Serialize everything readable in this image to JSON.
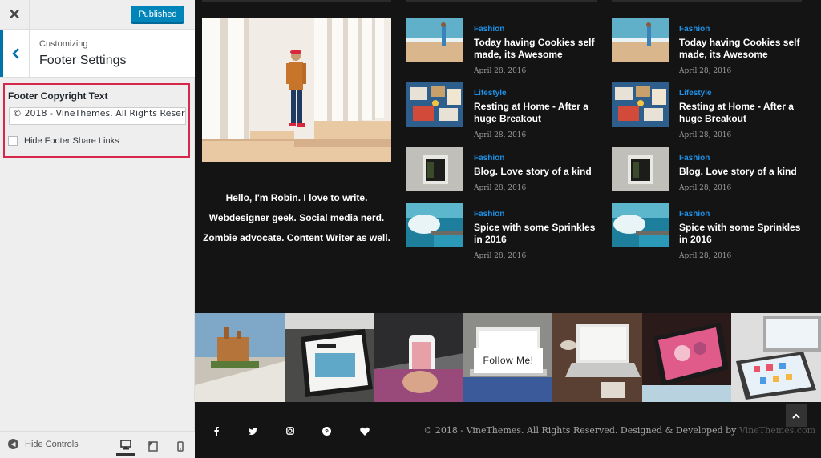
{
  "customizer": {
    "close_icon": "close-icon",
    "publish_label": "Published",
    "section_sub": "Customizing",
    "section_title": "Footer Settings",
    "field_label": "Footer Copyright Text",
    "field_value": "© 2018 - VineThemes. All Rights Reserv",
    "checkbox_label": "Hide Footer Share Links",
    "hide_controls_label": "Hide Controls"
  },
  "bio": {
    "lines": [
      "Hello, I'm Robin. I love to write.",
      "Webdesigner geek. Social media nerd.",
      "Zombie advocate. Content Writer as well."
    ]
  },
  "posts_col1": [
    {
      "category": "Fashion",
      "title": "Today having Cookies self made, its Awesome",
      "date": "April 28, 2016"
    },
    {
      "category": "Lifestyle",
      "title": "Resting at Home - After a huge Breakout",
      "date": "April 28, 2016"
    },
    {
      "category": "Fashion",
      "title": "Blog. Love story of a kind",
      "date": "April 28, 2016"
    },
    {
      "category": "Fashion",
      "title": "Spice with some Sprinkles in 2016",
      "date": "April 28, 2016"
    }
  ],
  "posts_col2": [
    {
      "category": "Fashion",
      "title": "Today having Cookies self made, its Awesome",
      "date": "April 28, 2016"
    },
    {
      "category": "Lifestyle",
      "title": "Resting at Home - After a huge Breakout",
      "date": "April 28, 2016"
    },
    {
      "category": "Fashion",
      "title": "Blog. Love story of a kind",
      "date": "April 28, 2016"
    },
    {
      "category": "Fashion",
      "title": "Spice with some Sprinkles in 2016",
      "date": "April 28, 2016"
    }
  ],
  "instagram": {
    "follow_label": "Follow Me!"
  },
  "footer": {
    "copyright_text": "© 2018 - VineThemes. All Rights Reserved. Designed & Developed by ",
    "copyright_brand": "VineThemes.com",
    "social_icons": [
      "facebook-icon",
      "twitter-icon",
      "instagram-icon",
      "pinterest-icon",
      "heart-icon"
    ]
  },
  "colors": {
    "accent_blue": "#1e90e6",
    "publish_blue": "#0085ba",
    "highlight_red": "#d6284a"
  }
}
